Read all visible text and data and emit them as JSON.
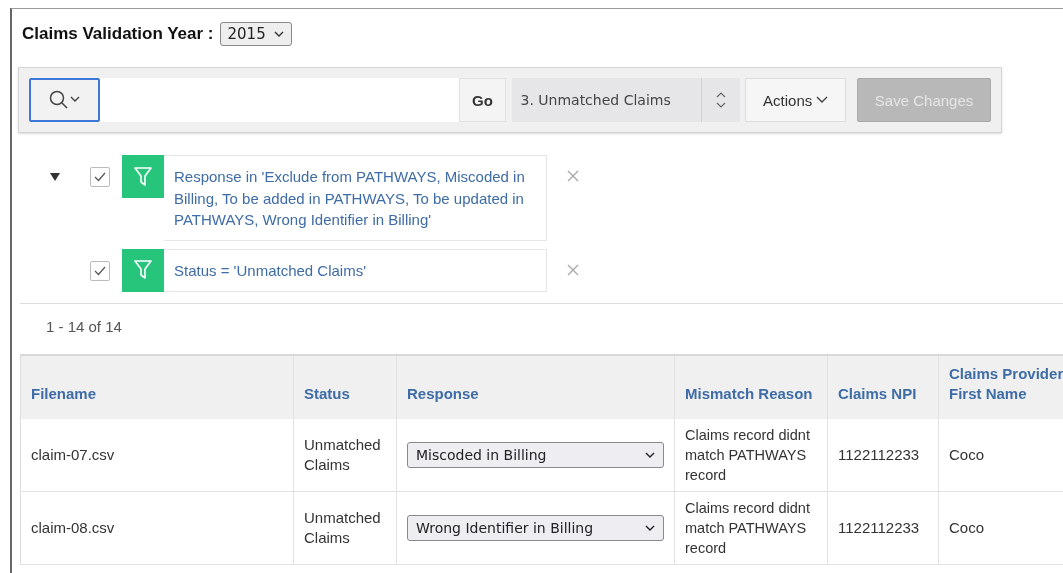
{
  "header": {
    "label": "Claims Validation Year :",
    "year": "2015"
  },
  "toolbar": {
    "go": "Go",
    "report": "3. Unmatched Claims",
    "actions": "Actions",
    "save": {
      "label": "Save Changes",
      "disabled": true
    }
  },
  "filters": {
    "expanded": true,
    "items": [
      {
        "checked": true,
        "text": "Response in 'Exclude from PATHWAYS, Miscoded in Billing, To be added in PATHWAYS, To be updated in PATHWAYS, Wrong Identifier in Billing'"
      },
      {
        "checked": true,
        "text": "Status = 'Unmatched Claims'"
      }
    ]
  },
  "pagination": "1 - 14 of 14",
  "table": {
    "columns": [
      "Filename",
      "Status",
      "Response",
      "Mismatch Reason",
      "Claims NPI",
      "Claims Provider First Name"
    ],
    "rows": [
      {
        "filename": "claim-07.csv",
        "status": "Unmatched Claims",
        "response": "Miscoded in Billing",
        "reason": "Claims record didnt match PATHWAYS record",
        "npi": "1122112233",
        "first_name": "Coco"
      },
      {
        "filename": "claim-08.csv",
        "status": "Unmatched Claims",
        "response": "Wrong Identifier in Billing",
        "reason": "Claims record didnt match PATHWAYS record",
        "npi": "1122112233",
        "first_name": "Coco"
      }
    ]
  }
}
